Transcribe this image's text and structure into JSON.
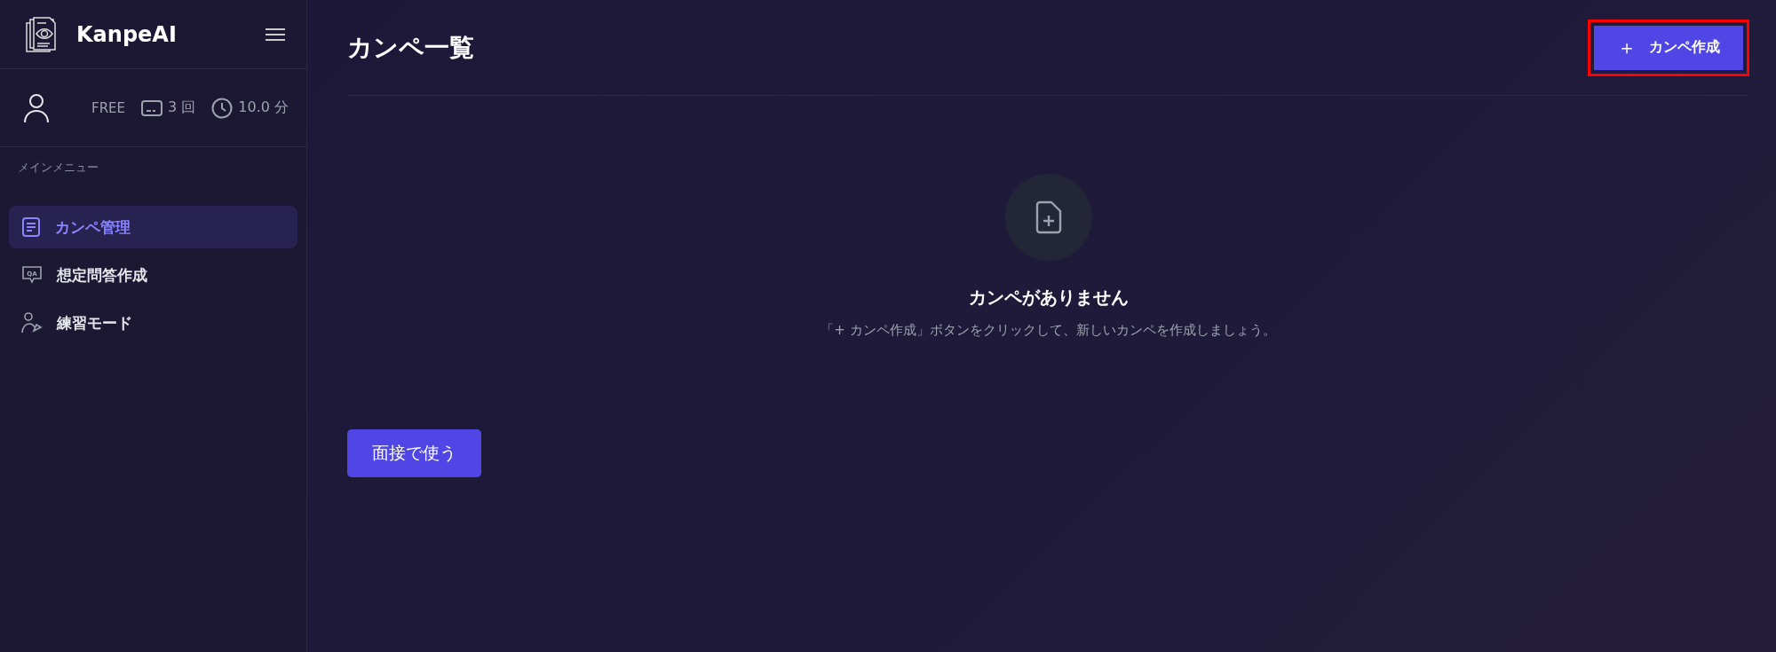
{
  "sidebar": {
    "app_name": "KanpeAI",
    "user": {
      "plan": "FREE",
      "count": "3 回",
      "minutes": "10.0 分"
    },
    "section_label": "メインメニュー",
    "items": [
      {
        "label": "カンペ管理",
        "kind": "document",
        "selected": true
      },
      {
        "label": "想定問答作成",
        "kind": "chat",
        "icon_text": "QA",
        "selected": false
      },
      {
        "label": "練習モード",
        "kind": "person",
        "selected": false
      }
    ]
  },
  "main": {
    "title": "カンペ一覧",
    "create_button": {
      "icon": "＋",
      "label": "カンペ作成",
      "highlighted": true
    },
    "empty_state": {
      "heading": "カンペがありません",
      "message": "「+ カンペ作成」ボタンをクリックして、新しいカンペを作成しましょう。"
    },
    "use_button": "面接で使う"
  }
}
